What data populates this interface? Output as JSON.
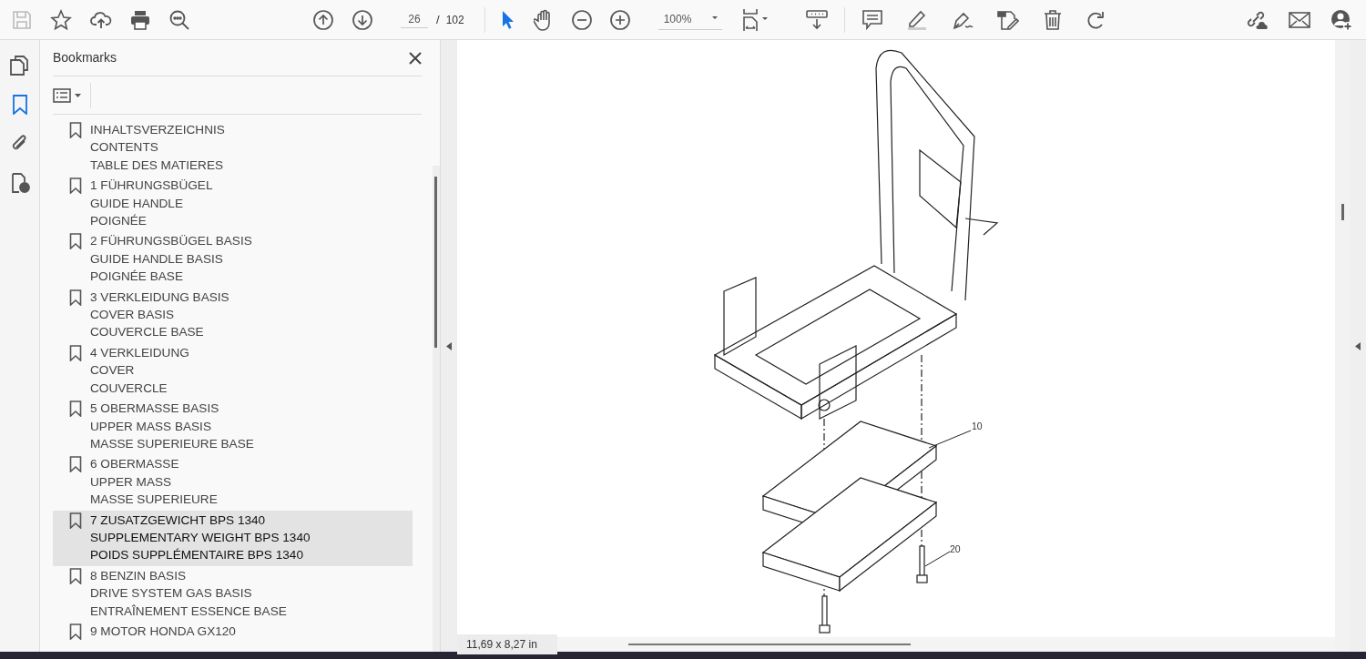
{
  "toolbar": {
    "page_current": "26",
    "page_total": "102",
    "page_separator": "/",
    "zoom": "100%",
    "pointer_tool": {
      "selected": true
    },
    "hand_tool": {
      "selected": false
    }
  },
  "rail": [
    {
      "selected": false
    },
    {
      "selected": true
    },
    {
      "selected": false
    },
    {
      "selected": false
    }
  ],
  "sidebar": {
    "title": "Bookmarks",
    "bookmarks": [
      {
        "lines": [
          "INHALTSVERZEICHNIS",
          "CONTENTS",
          "TABLE DES MATIERES"
        ],
        "selected": false
      },
      {
        "lines": [
          "1 FÜHRUNGSBÜGEL",
          "GUIDE HANDLE",
          "POIGNÉE"
        ],
        "selected": false
      },
      {
        "lines": [
          "2 FÜHRUNGSBÜGEL BASIS",
          "GUIDE HANDLE BASIS",
          "POIGNÉE BASE"
        ],
        "selected": false
      },
      {
        "lines": [
          "3 VERKLEIDUNG BASIS",
          "COVER BASIS",
          "COUVERCLE BASE"
        ],
        "selected": false
      },
      {
        "lines": [
          "4 VERKLEIDUNG",
          "COVER",
          "COUVERCLE"
        ],
        "selected": false
      },
      {
        "lines": [
          "5 OBERMASSE BASIS",
          "UPPER MASS BASIS",
          "MASSE SUPERIEURE BASE"
        ],
        "selected": false
      },
      {
        "lines": [
          "6 OBERMASSE",
          "UPPER MASS",
          "MASSE SUPERIEURE"
        ],
        "selected": false
      },
      {
        "lines": [
          "7 ZUSATZGEWICHT BPS 1340",
          "SUPPLEMENTARY WEIGHT  BPS 1340",
          "POIDS SUPPLÉMENTAIRE  BPS 1340"
        ],
        "selected": true
      },
      {
        "lines": [
          "8 BENZIN BASIS",
          "DRIVE SYSTEM GAS BASIS",
          "ENTRAÎNEMENT ESSENCE BASE"
        ],
        "selected": false
      },
      {
        "lines": [
          "9 MOTOR HONDA GX120"
        ],
        "selected": false
      }
    ]
  },
  "document": {
    "callouts": [
      "10",
      "20"
    ],
    "page_size": "11,69 x 8,27 in"
  }
}
